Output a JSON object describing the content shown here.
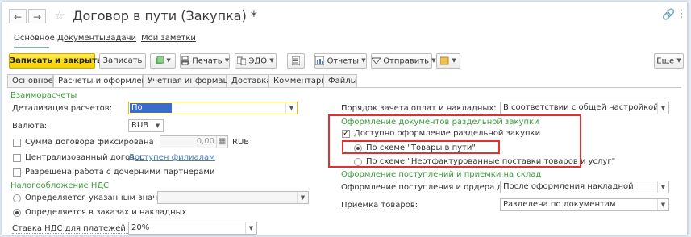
{
  "window": {
    "title": "Договор в пути (Закупка) *",
    "back": "←",
    "forward": "→"
  },
  "nav_tabs": [
    "Основное",
    "Документы",
    "Задачи",
    "Мои заметки"
  ],
  "toolbar": {
    "save_close": "Записать и закрыть",
    "save": "Записать",
    "print": "Печать",
    "edo": "ЭДО",
    "reports": "Отчеты",
    "send": "Отправить",
    "more": "Еще"
  },
  "form_tabs": [
    "Основное",
    "Расчеты и оформление",
    "Учетная информация",
    "Доставка",
    "Комментарий",
    "Файлы"
  ],
  "left": {
    "section_settlements": "Взаиморасчеты",
    "detail_label": "Детализация расчетов:",
    "detail_value": "По заказам",
    "currency_label": "Валюта:",
    "currency_value": "RUB",
    "fixed_sum_label": "Сумма договора фиксирована",
    "fixed_sum_value": "0,00",
    "fixed_sum_currency": "RUB",
    "centralized_label": "Централизованный договор",
    "branches_link": "Доступен филиалам",
    "subsidiaries_label": "Разрешена работа с дочерними партнерами",
    "section_vat": "Налогообложение НДС",
    "vat_opt1": "Определяется указанным значением",
    "vat_opt2": "Определяется в заказах и накладных",
    "vat_rate_label": "Ставка НДС для платежей:",
    "vat_rate_value": "20%"
  },
  "right": {
    "offset_label": "Порядок зачета оплат и накладных:",
    "offset_value": "В соответствии с общей настройкой",
    "section_separate": "Оформление документов раздельной закупки",
    "separate_checkbox": "Доступно оформление раздельной закупки",
    "scheme1": "По схеме \"Товары в пути\"",
    "scheme2": "По схеме \"Неотфактурованные поставки товаров и услуг\"",
    "section_receipt": "Оформление поступлений и приемки на склад",
    "receipt_label": "Оформление поступления и ордера доступно:",
    "receipt_value": "После оформления накладной",
    "acceptance_label": "Приемка товаров:",
    "acceptance_value": "Разделена по документам"
  },
  "colors": {
    "accent_yellow": "#f5d000",
    "section_green": "#3c9c3c",
    "highlight_red": "#e23030"
  }
}
